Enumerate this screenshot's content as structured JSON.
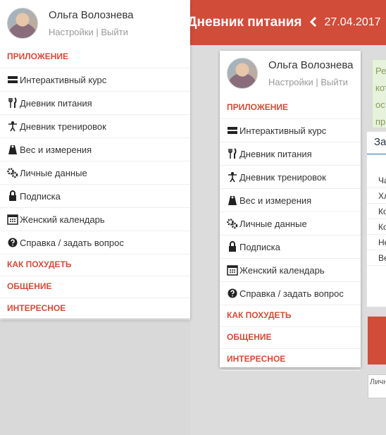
{
  "header": {
    "title": "Дневник питания",
    "back_icon": "chevron-left-icon",
    "date": "27.04.2017"
  },
  "user": {
    "name": "Ольга Волознева",
    "settings_label": "Настройки",
    "separator": "|",
    "logout_label": "Выйти"
  },
  "menu": {
    "section_app": "ПРИЛОЖЕНИЕ",
    "items": [
      {
        "label": "Интерактивный курс",
        "icon": "course-icon"
      },
      {
        "label": "Дневник питания",
        "icon": "fork-knife-icon"
      },
      {
        "label": "Дневник тренировок",
        "icon": "fitness-icon"
      },
      {
        "label": "Вес и измерения",
        "icon": "scale-icon"
      },
      {
        "label": "Личные данные",
        "icon": "gears-icon"
      },
      {
        "label": "Подписка",
        "icon": "lock-icon"
      },
      {
        "label": "Женский календарь",
        "icon": "calendar-icon"
      },
      {
        "label": "Справка / задать вопрос",
        "icon": "question-icon"
      }
    ],
    "section_lose": "КАК ПОХУДЕТЬ",
    "section_social": "ОБЩЕНИЕ",
    "section_interesting": "ИНТЕРЕСНОЕ"
  },
  "background": {
    "info_lines": [
      "Ре",
      "кот",
      "ос",
      "пр"
    ],
    "card_title": "За",
    "card_rows": [
      "Ча",
      "Хл",
      "Ко",
      "Ко",
      "Не",
      "Ве"
    ],
    "input_text": "Личн"
  },
  "colors": {
    "accent": "#d14c39",
    "info_bg": "#e6f2dc",
    "link_blue": "#2a6fa1"
  }
}
